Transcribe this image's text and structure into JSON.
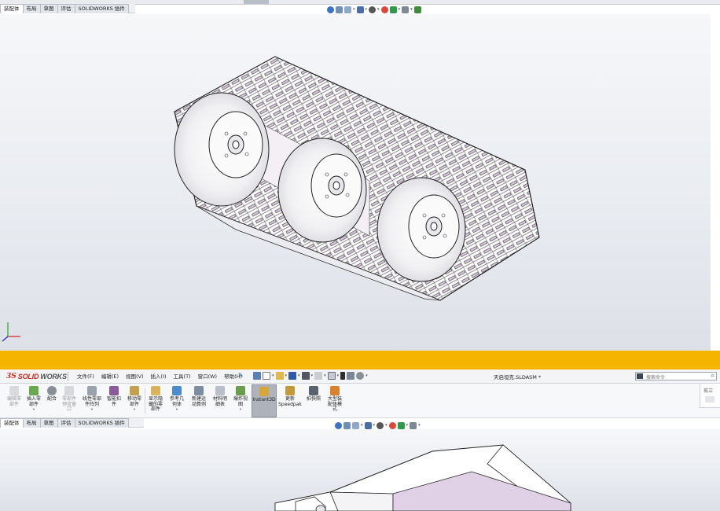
{
  "top_window": {
    "tabs": [
      "装配体",
      "布局",
      "草图",
      "评估",
      "SOLIDWORKS 插件"
    ],
    "active_tab_index": 0
  },
  "bottom_window": {
    "logo": {
      "ds": "3S",
      "solid": "SOLID",
      "works": "WORKS"
    },
    "menus": [
      "文件(F)",
      "编辑(E)",
      "视图(V)",
      "插入(I)",
      "工具(T)",
      "窗口(W)",
      "帮助(H)"
    ],
    "document_title": "天启坦克.SLDASM *",
    "search_placeholder": "搜索命令",
    "side_panel_label": "孤立",
    "commands": [
      {
        "label": "编辑零\n部件",
        "icon": "edit-component-icon",
        "enabled": false,
        "dropdown": false
      },
      {
        "label": "插入零\n部件",
        "icon": "insert-component-icon",
        "enabled": true,
        "dropdown": true
      },
      {
        "label": "配合",
        "icon": "mate-icon",
        "enabled": true,
        "dropdown": false
      },
      {
        "label": "零部件\n预览窗\n口",
        "icon": "component-preview-icon",
        "enabled": false,
        "dropdown": false
      },
      {
        "label": "线性零部\n件阵列",
        "icon": "linear-pattern-icon",
        "enabled": true,
        "dropdown": true
      },
      {
        "label": "智能扣\n件",
        "icon": "smart-fasteners-icon",
        "enabled": true,
        "dropdown": false
      },
      {
        "label": "移动零\n部件",
        "icon": "move-component-icon",
        "enabled": true,
        "dropdown": true
      },
      {
        "label": "显示隐\n藏的零\n部件",
        "icon": "show-hidden-icon",
        "enabled": true,
        "dropdown": false
      },
      {
        "label": "参考几\n何体",
        "icon": "reference-geometry-icon",
        "enabled": true,
        "dropdown": true
      },
      {
        "label": "新建运\n动算例",
        "icon": "new-motion-study-icon",
        "enabled": true,
        "dropdown": false
      },
      {
        "label": "材料明\n细表",
        "icon": "bill-of-materials-icon",
        "enabled": true,
        "dropdown": false
      },
      {
        "label": "爆炸视\n图",
        "icon": "exploded-view-icon",
        "enabled": true,
        "dropdown": true
      },
      {
        "label": "Instant3D",
        "icon": "instant3d-icon",
        "enabled": true,
        "dropdown": false,
        "selected": true
      },
      {
        "label": "更新\nSpeedpak",
        "icon": "speedpak-icon",
        "enabled": true,
        "dropdown": false
      },
      {
        "label": "拍快照",
        "icon": "snapshot-icon",
        "enabled": true,
        "dropdown": false
      },
      {
        "label": "大型装\n配体模\n式",
        "icon": "large-assembly-icon",
        "enabled": true,
        "dropdown": false
      }
    ],
    "tabs": [
      "装配体",
      "布局",
      "草图",
      "评估",
      "SOLIDWORKS 插件"
    ],
    "active_tab_index": 0
  },
  "colors": {
    "accent_band": "#f5b400",
    "brand_red": "#d7261e",
    "track_tint": "#d9c8de",
    "selection": "#aeb3bb"
  }
}
